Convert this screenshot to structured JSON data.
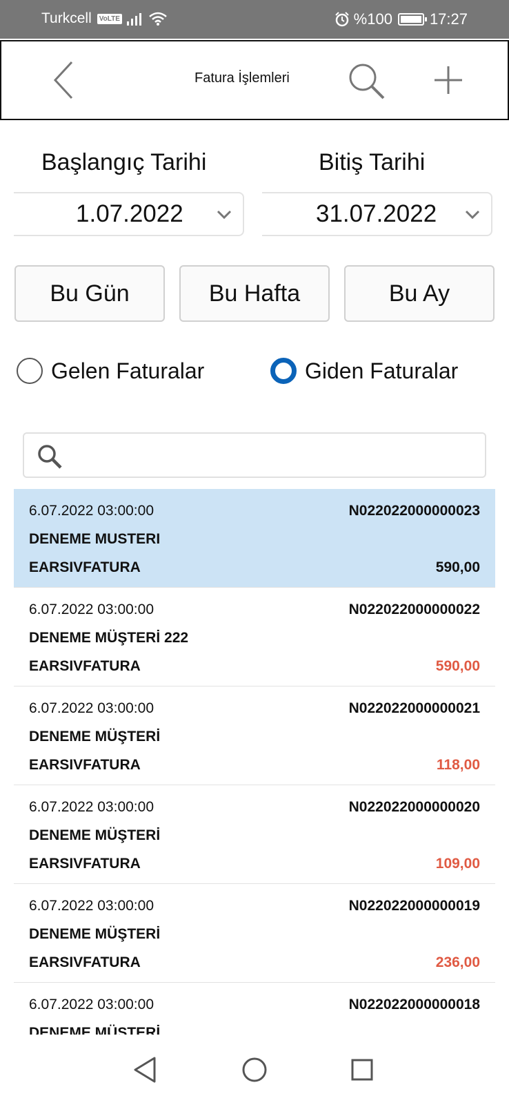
{
  "status_bar": {
    "carrier": "Turkcell",
    "volte": "VoLTE",
    "battery": "%100",
    "time": "17:27"
  },
  "app_bar": {
    "title": "Fatura İşlemleri"
  },
  "date_filter": {
    "start_label": "Başlangıç Tarihi",
    "end_label": "Bitiş Tarihi",
    "start_value": "1.07.2022",
    "end_value": "31.07.2022"
  },
  "quick_buttons": {
    "today": "Bu Gün",
    "week": "Bu Hafta",
    "month": "Bu Ay"
  },
  "radio": {
    "incoming": "Gelen Faturalar",
    "outgoing": "Giden Faturalar",
    "selected": "outgoing"
  },
  "list_search": {
    "value": "",
    "placeholder": ""
  },
  "invoices": [
    {
      "date": "6.07.2022 03:00:00",
      "number": "N022022000000023",
      "customer": "DENEME MUSTERI",
      "type": "EARSIVFATURA",
      "amount": "590,00",
      "selected": true
    },
    {
      "date": "6.07.2022 03:00:00",
      "number": "N022022000000022",
      "customer": "DENEME MÜŞTERİ 222",
      "type": "EARSIVFATURA",
      "amount": "590,00",
      "selected": false
    },
    {
      "date": "6.07.2022 03:00:00",
      "number": "N022022000000021",
      "customer": "DENEME MÜŞTERİ",
      "type": "EARSIVFATURA",
      "amount": "118,00",
      "selected": false
    },
    {
      "date": "6.07.2022 03:00:00",
      "number": "N022022000000020",
      "customer": "DENEME MÜŞTERİ",
      "type": "EARSIVFATURA",
      "amount": "109,00",
      "selected": false
    },
    {
      "date": "6.07.2022 03:00:00",
      "number": "N022022000000019",
      "customer": "DENEME MÜŞTERİ",
      "type": "EARSIVFATURA",
      "amount": "236,00",
      "selected": false
    },
    {
      "date": "6.07.2022 03:00:00",
      "number": "N022022000000018",
      "customer": "DENEME MÜŞTERİ",
      "type": "",
      "amount": "",
      "selected": false
    }
  ],
  "colors": {
    "accent": "#0b63b8",
    "selected_row": "#cce3f5",
    "amount": "#e05a43",
    "status_bar": "#777777"
  }
}
